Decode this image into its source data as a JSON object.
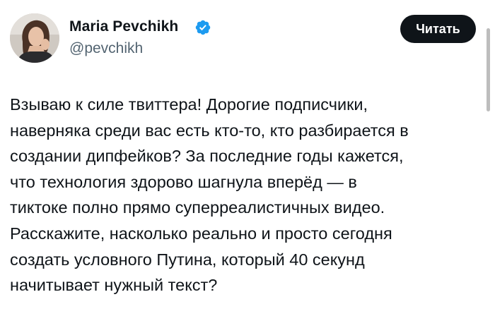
{
  "author": {
    "name": "Maria Pevchikh",
    "handle": "@pevchikh",
    "verified": true
  },
  "actions": {
    "follow_label": "Читать"
  },
  "tweet": {
    "text": "Взываю к силе твиттера! Дорогие подписчики,\nнаверняка среди вас есть кто-то, кто разбирается в\nсоздании дипфейков? За последние годы кажется,\nчто технология здорово шагнула вперёд — в\nтиктоке полно прямо суперреалистичных видео.\nРасскажите, насколько реально и просто сегодня\nсоздать условного Путина, который 40 секунд\nначитывает нужный текст?"
  },
  "icons": {
    "verified": "verified-badge-icon"
  },
  "colors": {
    "verified_blue": "#1d9bf0",
    "follow_button_bg": "#0f1419",
    "handle_gray": "#536471",
    "text": "#0f1419"
  }
}
